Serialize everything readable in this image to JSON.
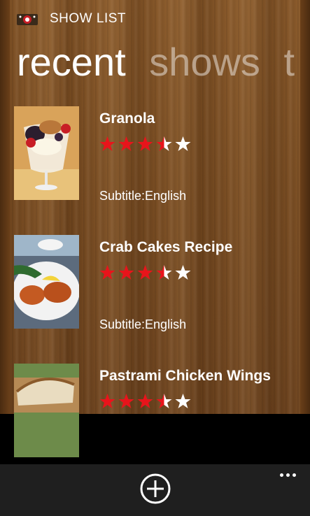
{
  "app": {
    "title": "SHOW LIST"
  },
  "pivot": {
    "tabs": [
      "recent",
      "shows",
      "t"
    ]
  },
  "items": [
    {
      "title": "Granola",
      "rating": 3.5,
      "subtitle": "Subtitle:English",
      "thumb": "granola-parfait"
    },
    {
      "title": "Crab Cakes Recipe",
      "rating": 3.5,
      "subtitle": "Subtitle:English",
      "thumb": "crab-cakes"
    },
    {
      "title": "Pastrami Chicken Wings",
      "rating": 3.5,
      "subtitle": "",
      "thumb": "bread"
    }
  ],
  "app_bar": {
    "add_icon": "plus-circle-icon",
    "more_icon": "ellipsis-icon"
  },
  "colors": {
    "star_filled": "#e8141b",
    "star_empty": "#ffffff",
    "app_bar": "#1f1f1f"
  }
}
